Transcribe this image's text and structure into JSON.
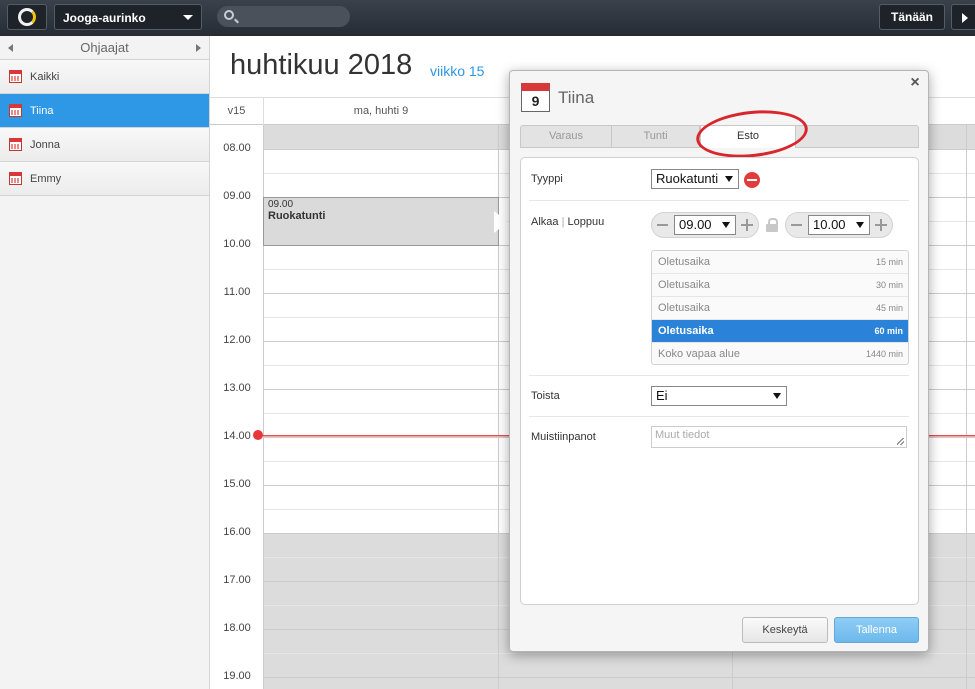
{
  "topbar": {
    "org_name": "Jooga-aurinko",
    "search_placeholder": "",
    "today_label": "Tänään"
  },
  "sidebar": {
    "header": "Ohjaajat",
    "items": [
      {
        "label": "Kaikki",
        "active": false
      },
      {
        "label": "Tiina",
        "active": true
      },
      {
        "label": "Jonna",
        "active": false
      },
      {
        "label": "Emmy",
        "active": false
      }
    ]
  },
  "main": {
    "title": "huhtikuu 2018",
    "week_link": "viikko 15",
    "week_col": "v15",
    "day_header": "ma, huhti 9",
    "hours": [
      "08.00",
      "09.00",
      "10.00",
      "11.00",
      "12.00",
      "13.00",
      "14.00",
      "15.00",
      "16.00",
      "17.00",
      "18.00",
      "19.00"
    ],
    "event": {
      "time": "09.00",
      "title": "Ruokatunti"
    }
  },
  "modal": {
    "calendar_icon_day": "9",
    "title": "Tiina",
    "tabs": [
      {
        "label": "Varaus",
        "active": false
      },
      {
        "label": "Tunti",
        "active": false
      },
      {
        "label": "Esto",
        "active": true
      }
    ],
    "type_label": "Tyyppi",
    "type_value": "Ruokatunti",
    "start_label": "Alkaa",
    "separator": "|",
    "end_label": "Loppuu",
    "start_value": "09.00",
    "end_value": "10.00",
    "durations": [
      {
        "label": "Oletusaika",
        "value": "15 min",
        "active": false
      },
      {
        "label": "Oletusaika",
        "value": "30 min",
        "active": false
      },
      {
        "label": "Oletusaika",
        "value": "45 min",
        "active": false
      },
      {
        "label": "Oletusaika",
        "value": "60 min",
        "active": true
      },
      {
        "label": "Koko vapaa alue",
        "value": "1440 min",
        "active": false
      }
    ],
    "repeat_label": "Toista",
    "repeat_value": "Ei",
    "notes_label": "Muistiinpanot",
    "notes_placeholder": "Muut tiedot",
    "cancel_label": "Keskeytä",
    "save_label": "Tallenna"
  },
  "colors": {
    "accent": "#2e97e6",
    "annotation": "#d8262c",
    "now_line": "#e8373a"
  }
}
